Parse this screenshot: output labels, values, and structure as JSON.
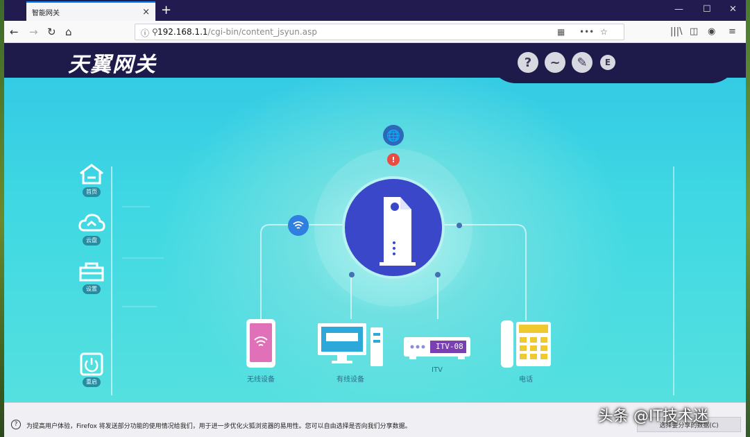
{
  "browser": {
    "tab_title": "智能网关",
    "tab_close": "×",
    "new_tab": "+",
    "controls": {
      "minimize": "—",
      "maximize": "☐",
      "close": "✕"
    },
    "url_host": "192.168.1.1",
    "url_path": "/cgi-bin/content_jsyun.asp",
    "nav": {
      "back": "←",
      "forward": "→",
      "reload": "↻",
      "home": "⌂"
    },
    "toolbar": {
      "reader": "▦",
      "more": "•••",
      "star": "☆",
      "library": "|||\\",
      "sidebar": "◫",
      "account": "◉",
      "menu": "≡"
    }
  },
  "page": {
    "logo": "天翼网关",
    "header_icons": [
      {
        "name": "help",
        "glyph": "?"
      },
      {
        "name": "status",
        "glyph": "~"
      },
      {
        "name": "settings",
        "glyph": "✎"
      },
      {
        "name": "exit",
        "glyph": "E"
      }
    ],
    "sidebar": [
      {
        "label": "首页"
      },
      {
        "label": "云盘"
      },
      {
        "label": "设置"
      },
      {
        "label": "重启"
      }
    ],
    "center": {
      "internet_icon": "🌐",
      "alert_count": "!",
      "wifi_glyph": "((•))"
    },
    "devices": [
      {
        "label": "无线设备"
      },
      {
        "label": "有线设备"
      },
      {
        "label": "ITV",
        "screen_text": "ITV-08"
      },
      {
        "label": "电话"
      }
    ]
  },
  "notification": {
    "icon": "?",
    "text": "为提高用户体验，Firefox 将发送部分功能的使用情况给我们，用于进一步优化火狐浏览器的易用性。您可以自由选择是否向我们分享数据。",
    "button_label": "选择要分享的数据(C)"
  },
  "watermark": "头条 @IT技术迷",
  "colors": {
    "header_bg": "#1e1a4a",
    "page_bg": "#3fd8e3",
    "router": "#3a47c9",
    "alert": "#e8342a"
  }
}
